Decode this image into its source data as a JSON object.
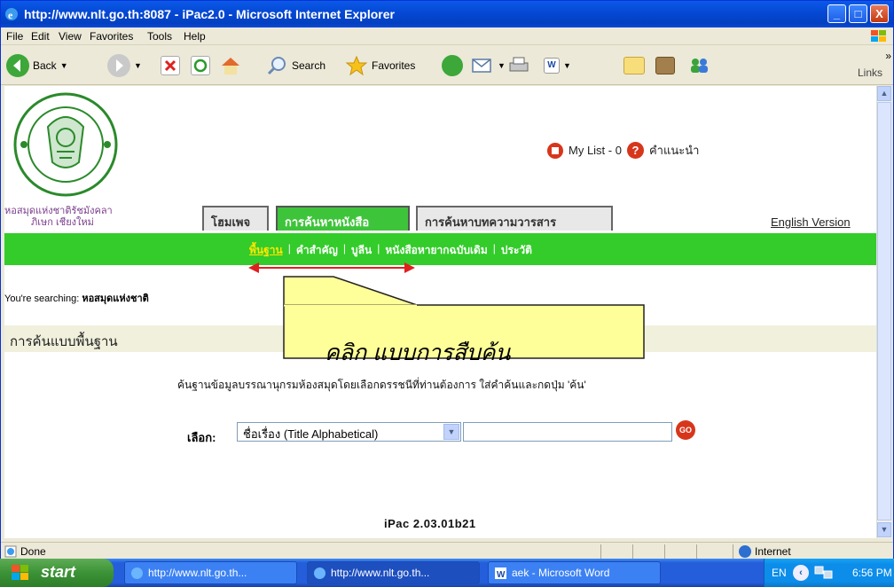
{
  "window": {
    "title": "http://www.nlt.go.th:8087 - iPac2.0 - Microsoft Internet Explorer",
    "controls": {
      "minimize": "_",
      "maximize": "□",
      "close": "X"
    }
  },
  "menu": [
    "File",
    "Edit",
    "View",
    "Favorites",
    "Tools",
    "Help"
  ],
  "toolbar": {
    "back": "Back",
    "search": "Search",
    "favorites": "Favorites",
    "links": "Links",
    "overflow": "»"
  },
  "page": {
    "library_name_line1": "หอสมุดแห่งชาติรัชมังคลา",
    "library_name_line2": "ภิเษก เชียงใหม่",
    "mylist": "My List - 0",
    "help": "คำแนะนำ",
    "tabs": [
      {
        "label": "โฮมเพจ",
        "active": false
      },
      {
        "label": "การค้นหาหนังสือ",
        "active": true
      },
      {
        "label": "การค้นหาบทความวารสาร",
        "active": false
      }
    ],
    "english_version": "English Version",
    "subnav": [
      "พื้นฐาน",
      "คำสำคัญ",
      "บูลีน",
      "หนังสือหายากฉบับเดิม",
      "ประวัติ"
    ],
    "subnav_sep": "|",
    "searching_prefix": "You're searching:",
    "searching_library": "หอสมุดแห่งชาติ",
    "section_title": "การค้นแบบพื้นฐาน",
    "description": "ค้นฐานข้อมูลบรรณานุกรมห้องสมุดโดยเลือกดรรชนีที่ท่านต้องการ ใส่คำค้นและกดปุ่ม 'ค้น'",
    "select_label": "เลือก:",
    "select_value": "ชื่อเรื่อง (Title Alphabetical)",
    "search_value": "",
    "go_label": "GO",
    "version": "iPac 2.03.01b21"
  },
  "callout": {
    "text": "คลิก แบบการสืบค้น",
    "fill": "#ffff99"
  },
  "status": {
    "left": "Done",
    "zone": "Internet"
  },
  "taskbar": {
    "start": "start",
    "tasks": [
      {
        "label": "http://www.nlt.go.th...",
        "active": false
      },
      {
        "label": "http://www.nlt.go.th...",
        "active": true
      },
      {
        "label": "aek - Microsoft Word",
        "active": false
      }
    ],
    "lang": "EN",
    "time": "6:56 PM"
  },
  "colors": {
    "green_bar": "#33cc2a",
    "active_tab": "#3ec43a",
    "accent_red": "#d7361b",
    "arrow_red": "#e02020"
  }
}
